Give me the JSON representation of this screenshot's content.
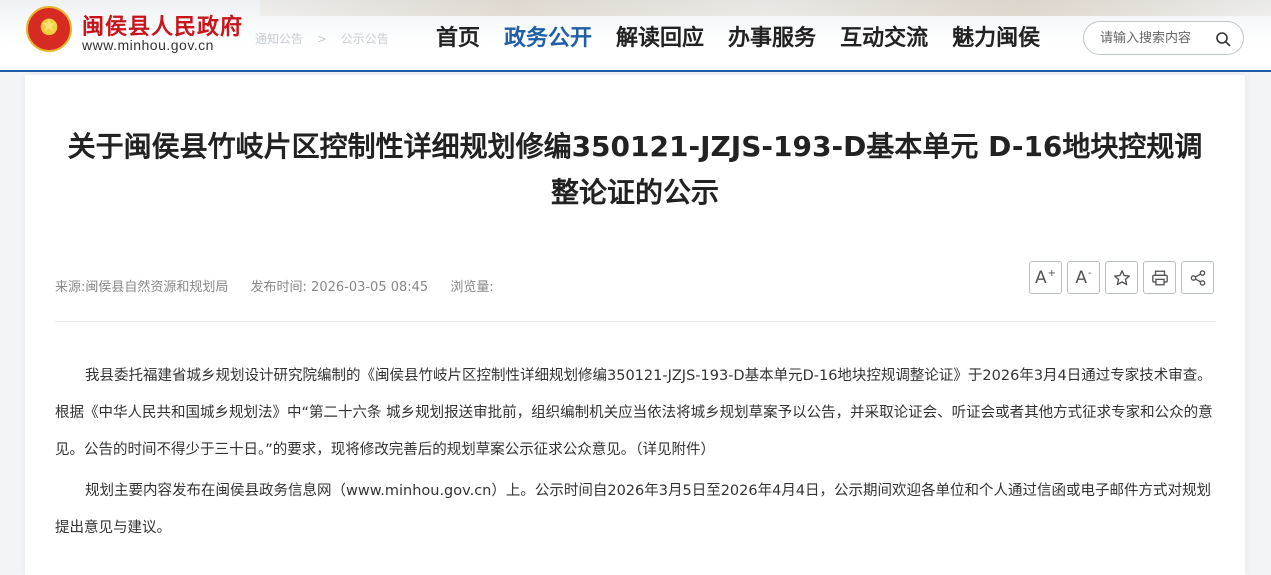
{
  "header": {
    "site_name": "闽侯县人民政府",
    "site_url": "www.minhou.gov.cn",
    "ghost_breadcrumb": [
      "通知公告",
      ">",
      "公示公告"
    ],
    "nav": [
      {
        "label": "首页",
        "active": false
      },
      {
        "label": "政务公开",
        "active": true
      },
      {
        "label": "解读回应",
        "active": false
      },
      {
        "label": "办事服务",
        "active": false
      },
      {
        "label": "互动交流",
        "active": false
      },
      {
        "label": "魅力闽侯",
        "active": false
      }
    ],
    "search_placeholder": "请输入搜索内容",
    "accent_color": "#1e5fa8",
    "brand_color": "#c8151b"
  },
  "article": {
    "title": "关于闽侯县竹岐片区控制性详细规划修编350121-JZJS-193-D基本单元 D-16地块控规调整论证的公示",
    "source": "来源:闽侯县自然资源和规划局",
    "published": "发布时间: 2026-03-05 08:45",
    "views": "浏览量:",
    "paragraphs": [
      "我县委托福建省城乡规划设计研究院编制的《闽侯县竹岐片区控制性详细规划修编350121-JZJS-193-D基本单元D-16地块控规调整论证》于2026年3月4日通过专家技术审查。根据《中华人民共和国城乡规划法》中“第二十六条 城乡规划报送审批前，组织编制机关应当依法将城乡规划草案予以公告，并采取论证会、听证会或者其他方式征求专家和公众的意见。公告的时间不得少于三十日。”的要求，现将修改完善后的规划草案公示征求公众意见。（详见附件）",
      "规划主要内容发布在闽侯县政务信息网（www.minhou.gov.cn）上。公示时间自2026年3月5日至2026年4月4日，公示期间欢迎各单位和个人通过信函或电子邮件方式对规划提出意见与建议。"
    ]
  },
  "tools": {
    "font_increase": "A",
    "font_increase_sup": "+",
    "font_decrease": "A",
    "font_decrease_sup": "-",
    "icons": [
      "font-increase-icon",
      "font-decrease-icon",
      "star-icon",
      "print-icon",
      "share-icon"
    ]
  }
}
